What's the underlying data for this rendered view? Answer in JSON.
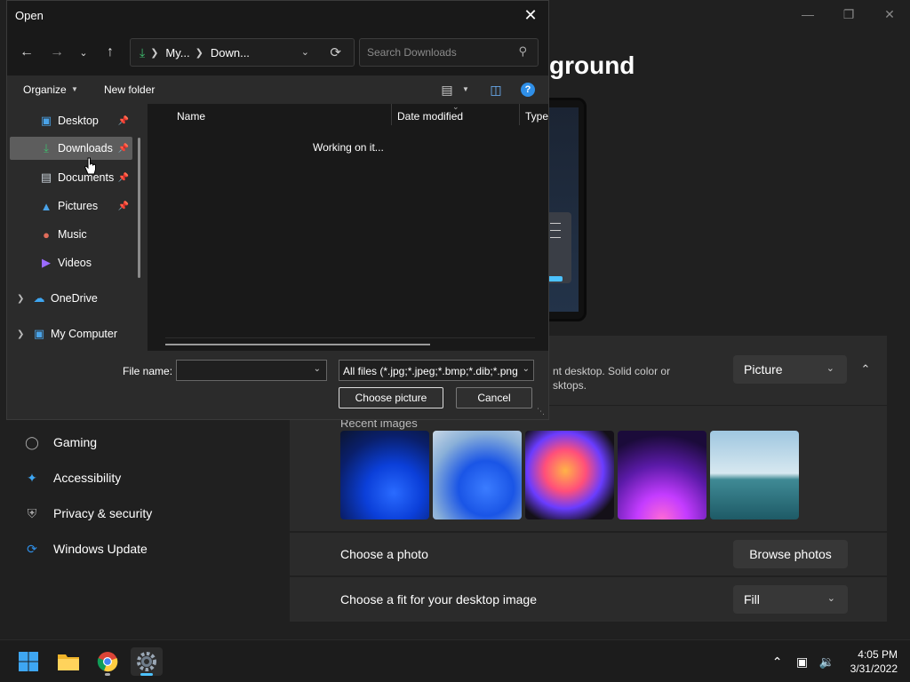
{
  "dialog": {
    "title": "Open",
    "address": {
      "seg1": "My...",
      "seg2": "Down..."
    },
    "search_placeholder": "Search Downloads",
    "toolbar": {
      "organize": "Organize",
      "new_folder": "New folder",
      "help": "?"
    },
    "tree": [
      {
        "label": "Desktop",
        "icon": "desktop-icon",
        "pinned": true
      },
      {
        "label": "Downloads",
        "icon": "download-icon",
        "pinned": true,
        "selected": true
      },
      {
        "label": "Documents",
        "icon": "document-icon",
        "pinned": true
      },
      {
        "label": "Pictures",
        "icon": "pictures-icon",
        "pinned": true
      },
      {
        "label": "Music",
        "icon": "music-icon",
        "pinned": false
      },
      {
        "label": "Videos",
        "icon": "videos-icon",
        "pinned": false
      },
      {
        "label": "OneDrive",
        "icon": "cloud-icon",
        "expandable": true
      },
      {
        "label": "My Computer",
        "icon": "computer-icon",
        "expandable": true
      }
    ],
    "columns": [
      "Name",
      "Date modified",
      "Type"
    ],
    "status": "Working on it...",
    "file_name_label": "File name:",
    "file_name_value": "",
    "filter": "All files (*.jpg;*.jpeg;*.bmp;*.dib;*.png",
    "choose_button": "Choose picture",
    "cancel_button": "Cancel"
  },
  "settings": {
    "page_title": "ground",
    "background_desc_line1": "nt desktop. Solid color or",
    "background_desc_line2": "sktops.",
    "background_type": "Picture",
    "recent_images_label": "Recent images",
    "choose_photo_label": "Choose a photo",
    "browse_button": "Browse photos",
    "fit_label": "Choose a fit for your desktop image",
    "fit_value": "Fill",
    "nav": [
      {
        "label": "Gaming",
        "icon": "gaming-icon"
      },
      {
        "label": "Accessibility",
        "icon": "accessibility-icon"
      },
      {
        "label": "Privacy & security",
        "icon": "shield-icon"
      },
      {
        "label": "Windows Update",
        "icon": "update-icon"
      }
    ]
  },
  "taskbar": {
    "apps": [
      "start-icon",
      "file-explorer-icon",
      "chrome-icon",
      "settings-icon"
    ],
    "time": "4:05 PM",
    "date": "3/31/2022"
  },
  "colors": {
    "accent": "#4cc2ff",
    "download_green": "#3fbf6f",
    "help_blue": "#2f8fe8"
  }
}
